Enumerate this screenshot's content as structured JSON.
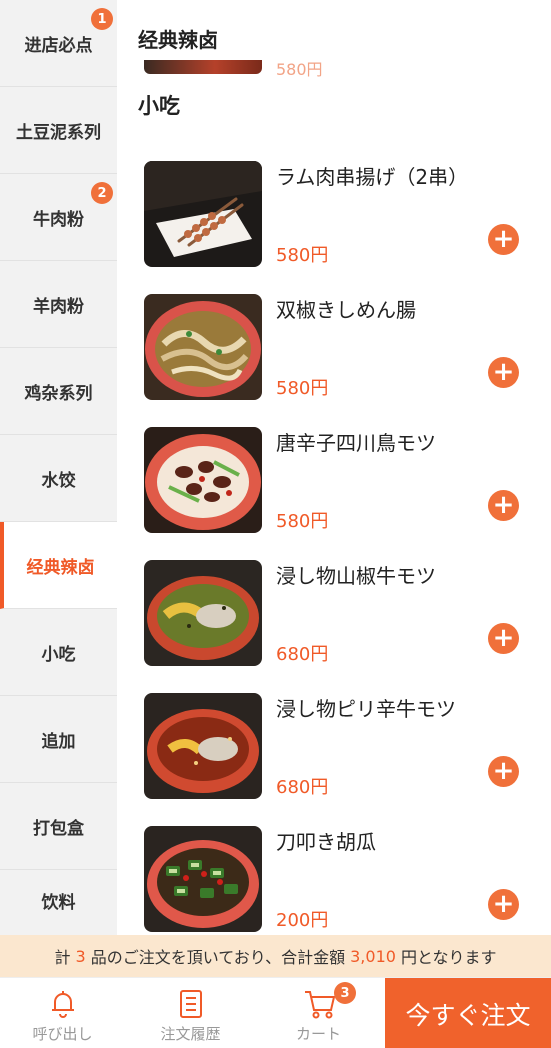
{
  "categories": [
    {
      "label": "进店必点",
      "badge": "1"
    },
    {
      "label": "土豆泥系列",
      "badge": ""
    },
    {
      "label": "牛肉粉",
      "badge": "2"
    },
    {
      "label": "羊肉粉",
      "badge": ""
    },
    {
      "label": "鸡杂系列",
      "badge": ""
    },
    {
      "label": "水饺",
      "badge": ""
    },
    {
      "label": "经典辣卤",
      "badge": "",
      "active": true
    },
    {
      "label": "小吃",
      "badge": ""
    },
    {
      "label": "追加",
      "badge": ""
    },
    {
      "label": "打包盒",
      "badge": ""
    },
    {
      "label": "饮料",
      "badge": ""
    }
  ],
  "main": {
    "sticky_header": "经典辣卤",
    "prev_price": "580円",
    "section_title": "小吃",
    "items": [
      {
        "name": "ラム肉串揚げ（2串）",
        "price": "580円"
      },
      {
        "name": "双椒きしめん腸",
        "price": "580円"
      },
      {
        "name": "唐辛子四川鳥モツ",
        "price": "580円"
      },
      {
        "name": "浸し物山椒牛モツ",
        "price": "680円"
      },
      {
        "name": "浸し物ピリ辛牛モツ",
        "price": "680円"
      },
      {
        "name": "刀叩き胡瓜",
        "price": "200円"
      }
    ],
    "add_symbol": "+"
  },
  "summary": {
    "prefix": "計",
    "count": "3",
    "middle": "品のご注文を頂いており、合計金額",
    "amount": "3,010",
    "suffix": "円となります"
  },
  "bottom_nav": {
    "call_label": "呼び出し",
    "history_label": "注文履歴",
    "cart_label": "カート",
    "cart_badge": "3",
    "order_label": "今すぐ注文"
  },
  "colors": {
    "accent": "#f05a28",
    "badge": "#f0703a",
    "summary_bg": "#fbe7cf"
  }
}
